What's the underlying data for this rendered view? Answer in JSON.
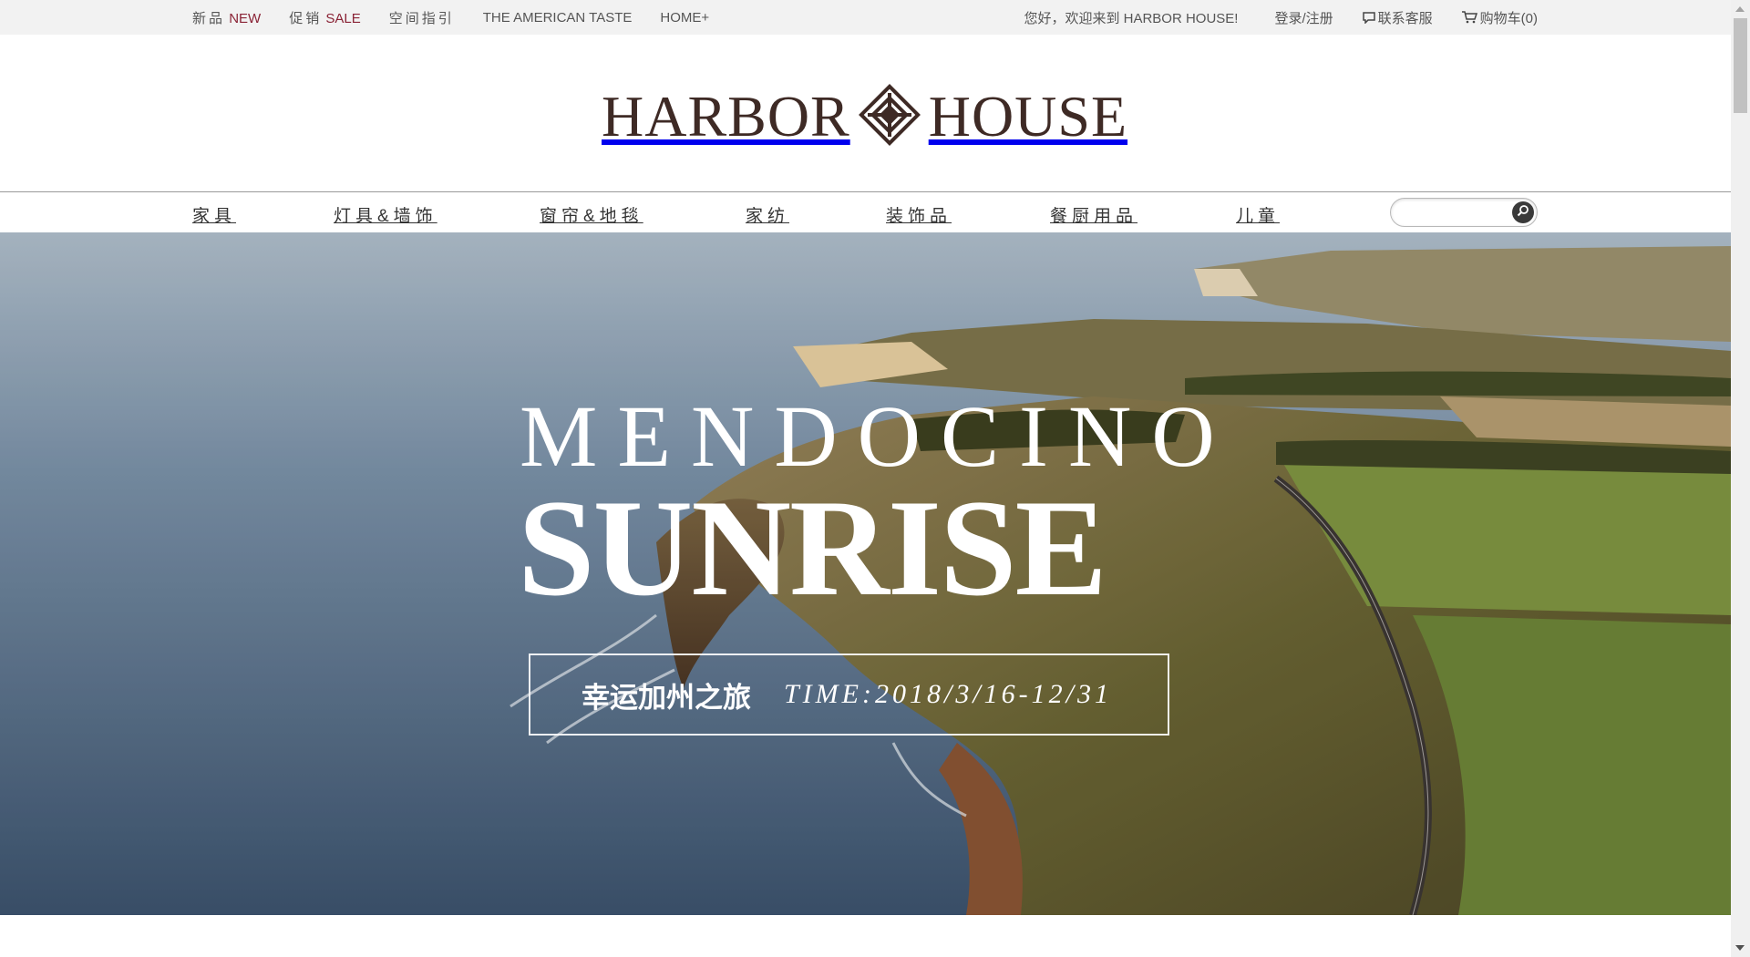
{
  "topbar": {
    "links": [
      {
        "cn": "新品",
        "en": "NEW"
      },
      {
        "cn": "促销",
        "en": "SALE"
      },
      {
        "cn": "空间指引",
        "en": ""
      },
      {
        "cn": "",
        "en": "THE AMERICAN TASTE"
      },
      {
        "cn": "",
        "en": "HOME+"
      }
    ],
    "welcome": "您好，欢迎来到 HARBOR HOUSE!",
    "login": "登录/注册",
    "service": "联系客服",
    "cart": "购物车(0)",
    "accent_color": "#8a2336"
  },
  "logo": {
    "word_left": "HARBOR",
    "word_right": "HOUSE",
    "color": "#3e2a25",
    "emblem_icon": "diamond-knot-icon"
  },
  "nav": {
    "items": [
      "家具",
      "灯具&墙饰",
      "窗帘&地毯",
      "家纺",
      "装饰品",
      "餐厨用品",
      "儿童"
    ],
    "search": {
      "placeholder": "",
      "value": "",
      "icon": "search-icon"
    }
  },
  "hero": {
    "line1": "MENDOCINO",
    "line2": "SUNRISE",
    "promo_cn": "幸运加州之旅",
    "promo_time": "TIME:2018/3/16-12/31"
  }
}
